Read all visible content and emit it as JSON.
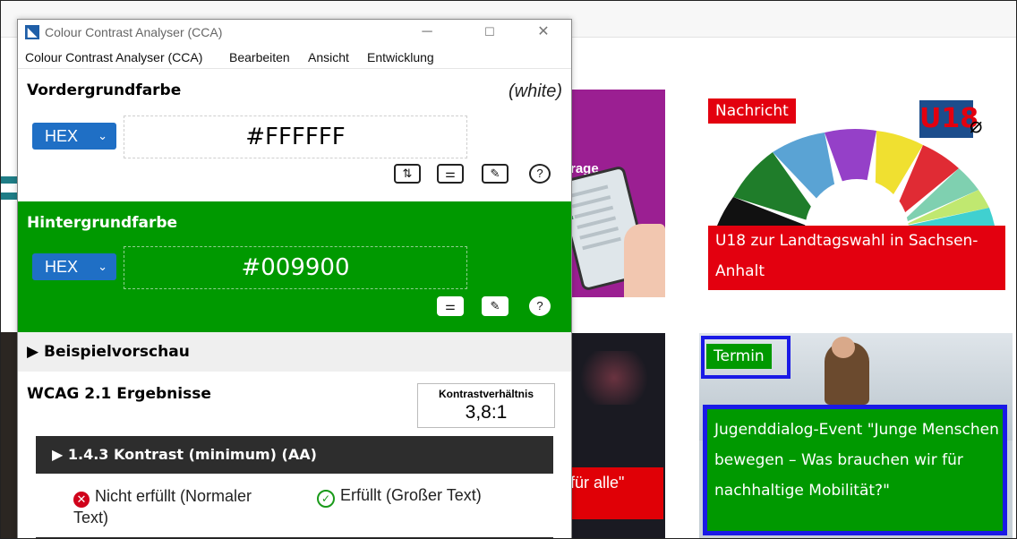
{
  "app": {
    "title": "Colour Contrast Analyser (CCA)",
    "window_controls": {
      "minimize": "─",
      "maximize": "☐",
      "close": "✕"
    },
    "menu": [
      "Colour Contrast Analyser (CCA)",
      "Bearbeiten",
      "Ansicht",
      "Entwicklung"
    ]
  },
  "foreground": {
    "title": "Vordergrundfarbe",
    "color_name": "(white)",
    "format": "HEX",
    "value": "#FFFFFF",
    "color": "#FFFFFF",
    "tools": [
      "swap-icon",
      "sliders-icon",
      "eyedropper-icon",
      "help-icon"
    ]
  },
  "background": {
    "title": "Hintergrundfarbe",
    "format": "HEX",
    "value": "#009900",
    "color": "#009900",
    "tools": [
      "sliders-icon",
      "eyedropper-icon",
      "help-icon"
    ]
  },
  "preview": {
    "label": "Beispielvorschau"
  },
  "results": {
    "title": "WCAG 2.1 Ergebnisse",
    "ratio_label": "Kontrastverhältnis",
    "ratio_value": "3,8:1",
    "criterion": "1.4.3 Kontrast (minimum) (AA)",
    "fail_text": "Nicht erfüllt (Normaler Text)",
    "pass_text": "Erfüllt (Großer Text)"
  },
  "website": {
    "card_a_text": "rage",
    "card_b_caption": "für alle\"",
    "card_c": {
      "badge": "Nachricht",
      "logo_text": "U18",
      "caption": "U18 zur Landtagswahl in Sachsen-Anhalt"
    },
    "card_d": {
      "badge": "Termin",
      "caption": "Jugenddialog-Event \"Junge Menschen bewegen – Was brauchen wir für nachhaltige Mobilität?\""
    },
    "colors": {
      "red": "#e3000f",
      "green": "#009900",
      "highlight": "#1a1ae6",
      "purple": "#9b1f92"
    }
  }
}
